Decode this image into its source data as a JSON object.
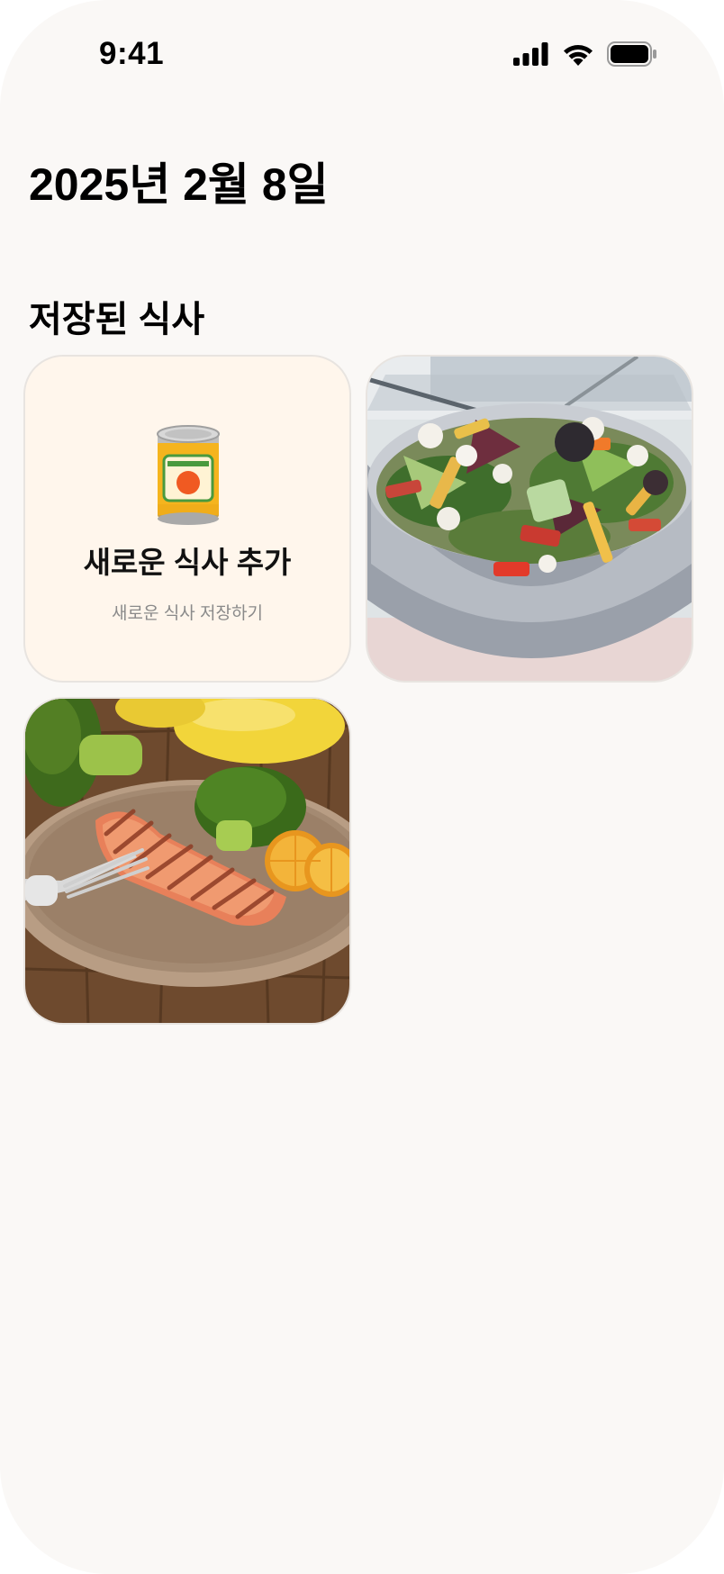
{
  "status_bar": {
    "time": "9:41",
    "icons": [
      "signal-icon",
      "wifi-icon",
      "battery-icon"
    ]
  },
  "header": {
    "date": "2025년 2월 8일"
  },
  "saved_meals": {
    "title": "저장된 식사",
    "add_card": {
      "icon": "canned-food-icon",
      "title": "새로운 식사 추가",
      "subtitle": "새로운 식사 저장하기"
    },
    "meals": [
      {
        "image": "salad-bowl-photo"
      },
      {
        "image": "grilled-salmon-photo"
      }
    ]
  },
  "colors": {
    "background": "#faf8f6",
    "add_card_background": "#fff6ec",
    "card_border": "#e8e4e0",
    "subtitle_text": "#8a8a8a"
  }
}
